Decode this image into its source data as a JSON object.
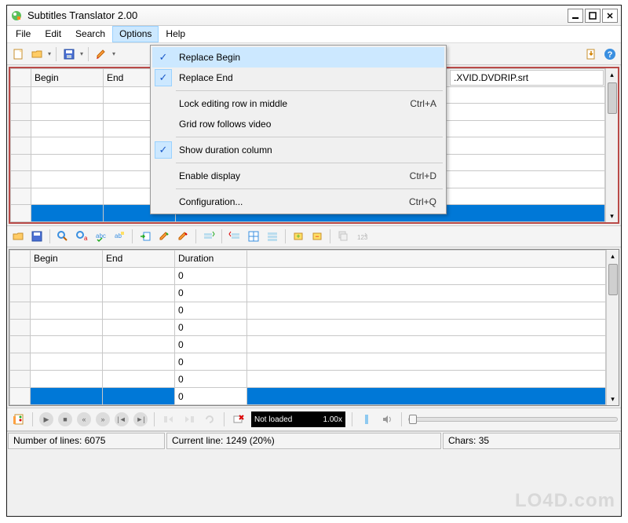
{
  "window": {
    "title": "Subtitles Translator 2.00"
  },
  "menu": {
    "items": [
      "File",
      "Edit",
      "Search",
      "Options",
      "Help"
    ],
    "open_index": 3
  },
  "options_menu": [
    {
      "label": "Replace Begin",
      "checked": true,
      "shortcut": "",
      "highlight": true
    },
    {
      "label": "Replace End",
      "checked": true,
      "shortcut": ""
    },
    {
      "sep": true
    },
    {
      "label": "Lock editing row in middle",
      "checked": false,
      "shortcut": "Ctrl+A"
    },
    {
      "label": "Grid row follows video",
      "checked": false,
      "shortcut": ""
    },
    {
      "sep": true
    },
    {
      "label": "Show duration column",
      "checked": true,
      "shortcut": ""
    },
    {
      "sep": true
    },
    {
      "label": "Enable display",
      "checked": false,
      "shortcut": "Ctrl+D"
    },
    {
      "sep": true
    },
    {
      "label": "Configuration...",
      "checked": false,
      "shortcut": "Ctrl+Q"
    }
  ],
  "top_grid": {
    "headers": [
      "Begin",
      "End"
    ],
    "filename_visible": ".XVID.DVDRIP.srt",
    "rows": [
      {
        "begin": "",
        "end": ""
      },
      {
        "begin": "",
        "end": ""
      },
      {
        "begin": "",
        "end": ""
      },
      {
        "begin": "",
        "end": ""
      },
      {
        "begin": "",
        "end": ""
      },
      {
        "begin": "",
        "end": ""
      },
      {
        "begin": "",
        "end": ""
      },
      {
        "begin": "",
        "end": "",
        "selected": true
      }
    ]
  },
  "bottom_grid": {
    "headers": [
      "Begin",
      "End",
      "Duration"
    ],
    "rows": [
      {
        "begin": "",
        "end": "",
        "duration": "0"
      },
      {
        "begin": "",
        "end": "",
        "duration": "0"
      },
      {
        "begin": "",
        "end": "",
        "duration": "0"
      },
      {
        "begin": "",
        "end": "",
        "duration": "0"
      },
      {
        "begin": "",
        "end": "",
        "duration": "0"
      },
      {
        "begin": "",
        "end": "",
        "duration": "0"
      },
      {
        "begin": "",
        "end": "",
        "duration": "0"
      },
      {
        "begin": "",
        "end": "",
        "duration": "0",
        "selected": true
      }
    ]
  },
  "video": {
    "status": "Not loaded",
    "speed": "1.00x"
  },
  "status": {
    "lines_label": "Number of lines:",
    "lines_value": "6075",
    "current_label": "Current line:",
    "current_value": "1249 (20%)",
    "chars_label": "Chars:",
    "chars_value": "35"
  },
  "watermark": "LO4D.com"
}
